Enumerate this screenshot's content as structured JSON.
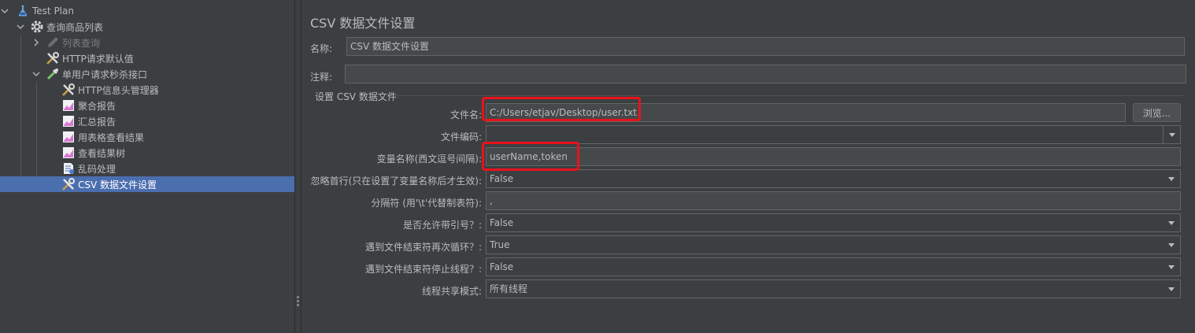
{
  "tree": {
    "items": [
      {
        "label": "Test Plan",
        "icon": "flask-icon",
        "expanded": true
      },
      {
        "label": "查询商品列表",
        "icon": "gear-icon",
        "expanded": true
      },
      {
        "label": "列表查询",
        "icon": "pen-icon",
        "disabled": true
      },
      {
        "label": "HTTP请求默认值",
        "icon": "tools-icon"
      },
      {
        "label": "单用户请求秒杀接口",
        "icon": "pipette-icon",
        "expanded": true
      },
      {
        "label": "HTTP信息头管理器",
        "icon": "tools-icon"
      },
      {
        "label": "聚合报告",
        "icon": "chart-icon"
      },
      {
        "label": "汇总报告",
        "icon": "chart-icon"
      },
      {
        "label": "用表格查看结果",
        "icon": "chart-icon"
      },
      {
        "label": "查看结果树",
        "icon": "chart-icon"
      },
      {
        "label": "乱码处理",
        "icon": "script-icon"
      },
      {
        "label": "CSV 数据文件设置",
        "icon": "tools-icon",
        "selected": true
      }
    ]
  },
  "panel": {
    "title": "CSV 数据文件设置",
    "name_label": "名称:",
    "name_value": "CSV 数据文件设置",
    "comment_label": "注释:",
    "comment_value": "",
    "group_title": "设置 CSV 数据文件",
    "filename_label": "文件名:",
    "filename_value": "C:/Users/etjav/Desktop/user.txt",
    "browse_label": "浏览...",
    "encoding_label": "文件编码:",
    "encoding_value": "",
    "varnames_label": "变量名称(西文逗号间隔):",
    "varnames_value": "userName,token",
    "ignore_first_label": "忽略首行(只在设置了变量名称后才生效):",
    "ignore_first_value": "False",
    "delimiter_label": "分隔符 (用'\\t'代替制表符):",
    "delimiter_value": ",",
    "quoted_label": "是否允许带引号？:",
    "quoted_value": "False",
    "recycle_label": "遇到文件结束符再次循环？:",
    "recycle_value": "True",
    "stop_label": "遇到文件结束符停止线程？:",
    "stop_value": "False",
    "share_label": "线程共享模式:",
    "share_value": "所有线程"
  },
  "colors": {
    "background": "#3c3f41",
    "selection": "#4b6eaf",
    "highlight": "#e8121b"
  }
}
